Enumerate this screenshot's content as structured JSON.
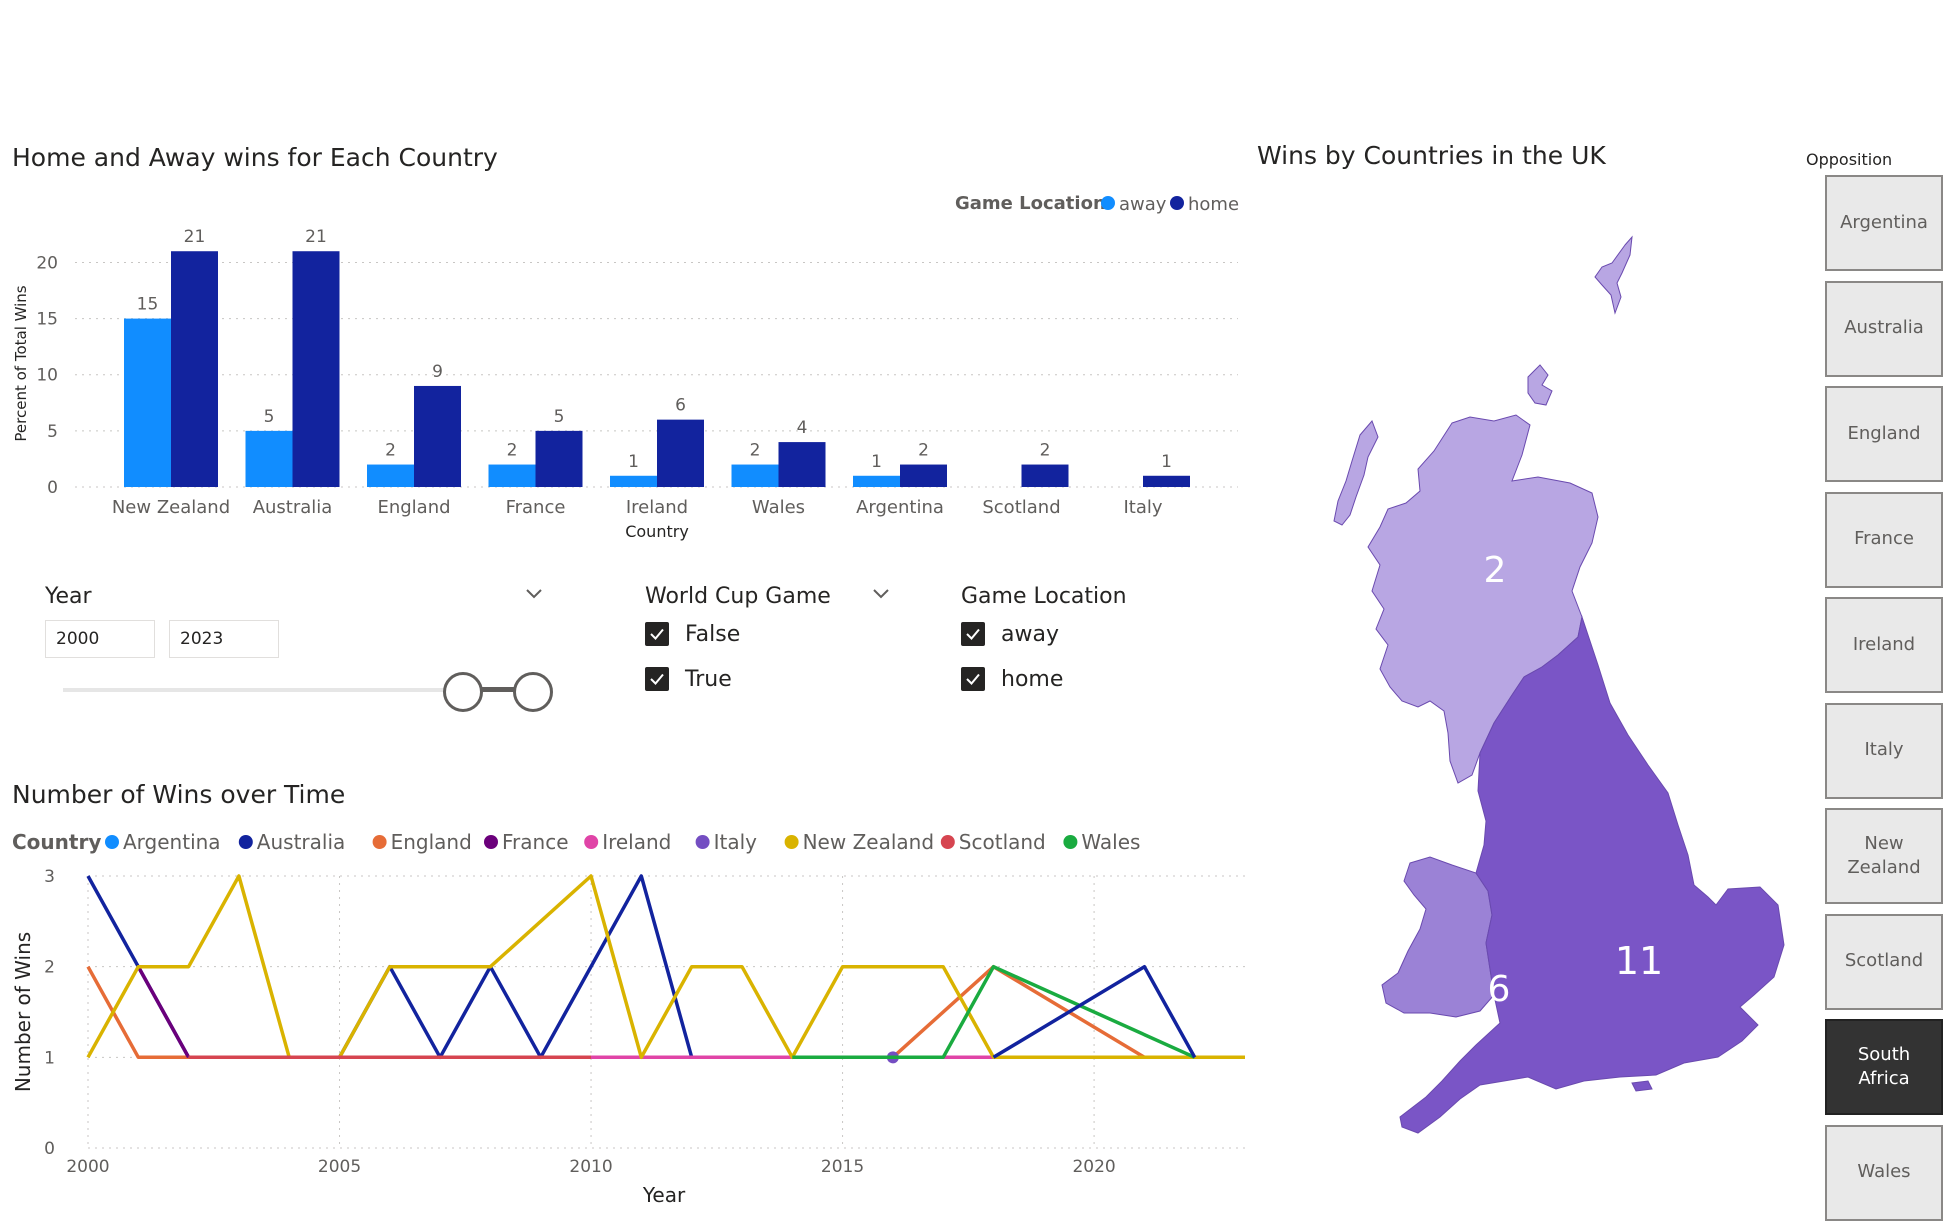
{
  "bar_visual": {
    "title": "Home and Away wins for Each Country"
  },
  "map_visual": {
    "title": "Wins by Countries in the UK",
    "region_labels": {
      "scotland": "2",
      "wales": "6",
      "england": "11"
    },
    "colors": {
      "scotland": "#b8a6e3",
      "wales": "#9b82d6",
      "england": "#7a55c6",
      "stroke": "#6a4aaf"
    }
  },
  "line_visual": {
    "title": "Number of Wins over Time"
  },
  "year_slicer": {
    "title": "Year",
    "start_value": "2000",
    "end_value": "2023",
    "range_fraction": [
      0.0,
      1.0
    ]
  },
  "worldcup_slicer": {
    "title": "World Cup Game",
    "items": [
      {
        "label": "False",
        "checked": true
      },
      {
        "label": "True",
        "checked": true
      }
    ]
  },
  "location_slicer": {
    "title": "Game Location",
    "items": [
      {
        "label": "away",
        "checked": true
      },
      {
        "label": "home",
        "checked": true
      }
    ]
  },
  "opposition_slicer": {
    "title": "Opposition",
    "items": [
      {
        "label": "Argentina",
        "selected": false
      },
      {
        "label": "Australia",
        "selected": false
      },
      {
        "label": "England",
        "selected": false
      },
      {
        "label": "France",
        "selected": false
      },
      {
        "label": "Ireland",
        "selected": false
      },
      {
        "label": "Italy",
        "selected": false
      },
      {
        "label": "New Zealand",
        "selected": false
      },
      {
        "label": "Scotland",
        "selected": false
      },
      {
        "label": "South Africa",
        "selected": true
      },
      {
        "label": "Wales",
        "selected": false
      }
    ]
  },
  "chart_data": [
    {
      "type": "bar",
      "title": "Home and Away wins for Each Country",
      "xlabel": "Country",
      "ylabel": "Percent of Total Wins",
      "ylim": [
        0,
        22
      ],
      "yticks": [
        0,
        5,
        10,
        15,
        20
      ],
      "grid": true,
      "legend_title": "Game Location",
      "legend_position": "top-right",
      "categories": [
        "New Zealand",
        "Australia",
        "England",
        "France",
        "Ireland",
        "Wales",
        "Argentina",
        "Scotland",
        "Italy"
      ],
      "series": [
        {
          "name": "away",
          "color": "#118dff",
          "values": [
            15,
            5,
            2,
            2,
            1,
            2,
            1,
            null,
            null
          ]
        },
        {
          "name": "home",
          "color": "#12239e",
          "values": [
            21,
            21,
            9,
            5,
            6,
            4,
            2,
            2,
            1
          ]
        }
      ]
    },
    {
      "type": "line",
      "title": "Number of Wins over Time",
      "xlabel": "Year",
      "ylabel": "Number of Wins",
      "xlim": [
        2000,
        2023
      ],
      "ylim": [
        0,
        3
      ],
      "xticks": [
        2000,
        2005,
        2010,
        2015,
        2020
      ],
      "yticks": [
        0,
        1,
        2,
        3
      ],
      "grid": true,
      "legend_title": "Country",
      "legend_position": "top-left",
      "series": [
        {
          "name": "Argentina",
          "color": "#118dff",
          "points": []
        },
        {
          "name": "Australia",
          "color": "#12239e",
          "points": [
            [
              2000,
              3
            ],
            [
              2001,
              2
            ],
            [
              2002,
              1
            ],
            [
              2005,
              1
            ],
            [
              2006,
              2
            ],
            [
              2007,
              1
            ],
            [
              2008,
              2
            ],
            [
              2009,
              1
            ],
            [
              2011,
              3
            ],
            [
              2012,
              1
            ]
          ]
        },
        {
          "name": "England",
          "color": "#e66c37",
          "points": [
            [
              2000,
              2
            ],
            [
              2001,
              1
            ],
            [
              2016,
              1
            ],
            [
              2018,
              2
            ],
            [
              2021,
              1
            ]
          ]
        },
        {
          "name": "France",
          "color": "#6b007b",
          "points": [
            [
              2001,
              2
            ],
            [
              2002,
              1
            ]
          ]
        },
        {
          "name": "Ireland",
          "color": "#e044a7",
          "points": [
            [
              2010,
              1
            ],
            [
              2014,
              1
            ],
            [
              2018,
              1
            ]
          ]
        },
        {
          "name": "Italy",
          "color": "#744ec2",
          "points": [
            [
              2016,
              1
            ]
          ]
        },
        {
          "name": "New Zealand",
          "color": "#d9b300",
          "points": [
            [
              2000,
              1
            ],
            [
              2001,
              2
            ],
            [
              2002,
              2
            ],
            [
              2003,
              3
            ],
            [
              2004,
              1
            ],
            [
              2005,
              1
            ],
            [
              2006,
              2
            ],
            [
              2008,
              2
            ],
            [
              2010,
              3
            ],
            [
              2011,
              1
            ],
            [
              2012,
              2
            ],
            [
              2013,
              2
            ],
            [
              2014,
              1
            ],
            [
              2015,
              2
            ],
            [
              2017,
              2
            ],
            [
              2018,
              1
            ],
            [
              2023,
              1
            ]
          ]
        },
        {
          "name": "Scotland",
          "color": "#d64550",
          "points": [
            [
              2002,
              1
            ],
            [
              2010,
              1
            ]
          ]
        },
        {
          "name": "Wales",
          "color": "#1aab40",
          "points": [
            [
              2014,
              1
            ],
            [
              2017,
              1
            ],
            [
              2018,
              2
            ],
            [
              2022,
              1
            ]
          ]
        }
      ],
      "extra_segments": [
        {
          "name": "Australia",
          "color": "#12239e",
          "points": [
            [
              2018,
              1
            ],
            [
              2021,
              2
            ],
            [
              2022,
              1
            ]
          ]
        }
      ]
    }
  ]
}
